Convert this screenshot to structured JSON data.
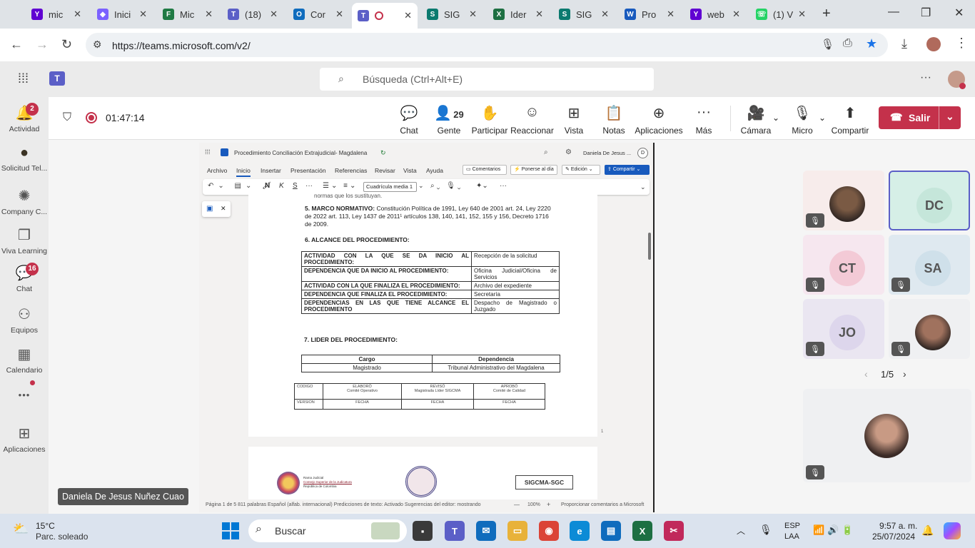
{
  "browser": {
    "tabs": [
      {
        "label": "mic",
        "color": "#6001d2",
        "glyph": "Y"
      },
      {
        "label": "Inici",
        "color": "#7b61ff",
        "glyph": "◆"
      },
      {
        "label": "Mic",
        "color": "#1f7a44",
        "glyph": "F"
      },
      {
        "label": "(18)",
        "color": "#5b5fc7",
        "glyph": "T"
      },
      {
        "label": "Cor",
        "color": "#0f6cbd",
        "glyph": "O"
      },
      {
        "label": "",
        "color": "#5b5fc7",
        "glyph": "T"
      },
      {
        "label": "SIG",
        "color": "#0b7a6f",
        "glyph": "S"
      },
      {
        "label": "Ider",
        "color": "#1d6f42",
        "glyph": "X"
      },
      {
        "label": "SIG",
        "color": "#0b7a6f",
        "glyph": "S"
      },
      {
        "label": "Pro",
        "color": "#185abd",
        "glyph": "W"
      },
      {
        "label": "web",
        "color": "#6001d2",
        "glyph": "Y"
      },
      {
        "label": "(1) V",
        "color": "#25d366",
        "glyph": "☏"
      }
    ],
    "url": "https://teams.microsoft.com/v2/"
  },
  "teams": {
    "search_placeholder": "Búsqueda (Ctrl+Alt+E)",
    "timer": "01:47:14",
    "rail": [
      {
        "label": "Actividad",
        "icon": "bell-icon",
        "glyph": "🔔",
        "badge": "2"
      },
      {
        "label": "Solicitud Tel...",
        "icon": "seal-icon",
        "glyph": "●",
        "badge": ""
      },
      {
        "label": "Company C...",
        "icon": "company-icon",
        "glyph": "✺",
        "badge": ""
      },
      {
        "label": "Viva Learning",
        "icon": "book-icon",
        "glyph": "❐",
        "badge": ""
      },
      {
        "label": "Chat",
        "icon": "chat-icon",
        "glyph": "💬",
        "badge": "16"
      },
      {
        "label": "Equipos",
        "icon": "teams-icon",
        "glyph": "⚇",
        "badge": ""
      },
      {
        "label": "Calendario",
        "icon": "calendar-icon",
        "glyph": "▦",
        "badge": ""
      },
      {
        "label": "",
        "icon": "more-icon",
        "glyph": "•••",
        "badge": ""
      },
      {
        "label": "Aplicaciones",
        "icon": "plus-icon",
        "glyph": "⊞",
        "badge": ""
      }
    ],
    "toolbar": {
      "chat": "Chat",
      "people": "Gente",
      "people_count": "29",
      "raise": "Participar",
      "react": "Reaccionar",
      "view": "Vista",
      "notes": "Notas",
      "apps": "Aplicaciones",
      "more": "Más",
      "camera": "Cámara",
      "mic": "Micro",
      "share": "Compartir",
      "leave": "Salir"
    },
    "participants": [
      {
        "initials": "",
        "bg": "#f7eceb",
        "avbg": "#7a5a44",
        "muted": true
      },
      {
        "initials": "DC",
        "bg": "#d6efe7",
        "avbg": "#c5e6da",
        "muted": false
      },
      {
        "initials": "CT",
        "bg": "#f6e7ef",
        "avbg": "#f3cad6",
        "muted": true
      },
      {
        "initials": "SA",
        "bg": "#dfe9f0",
        "avbg": "#cfe0ea",
        "muted": true
      },
      {
        "initials": "JO",
        "bg": "#eae6f1",
        "avbg": "#ddd6ec",
        "muted": true
      },
      {
        "initials": "",
        "bg": "#eff0f2",
        "avbg": "#a0725e",
        "muted": true
      }
    ],
    "pager": "1/5",
    "presenter_name": "Daniela De Jesus Nuñez Cuao"
  },
  "word": {
    "doc_title": "Procedimiento Conciliación Extrajudicial- Magdalena",
    "user": "Daniela De Jesus ...",
    "user_initial": "D",
    "menu": [
      "Archivo",
      "Inicio",
      "Insertar",
      "Presentación",
      "Referencias",
      "Revisar",
      "Vista",
      "Ayuda"
    ],
    "btn_comments": "Comentarios",
    "btn_catchup": "Ponerse al día",
    "btn_edit": "Edición",
    "btn_share": "Compartir",
    "style_box": "Cuadrícula media 1",
    "cut_text": "normas que los sustituyan.",
    "section5_title": "5. MARCO NORMATIVO:",
    "section5_body": "Constitución Política de 1991, Ley 640 de 2001 art. 24, Ley 2220 de 2022 art. 113, Ley 1437 de 2011¹ artículos 138, 140, 141, 152, 155 y 156, Decreto 1716 de 2009.",
    "section6_title": "6. ALCANCE DEL PROCEDIMIENTO:",
    "scope_rows": [
      {
        "k": "ACTIVIDAD CON LA QUE SE DA INICIO AL PROCEDIMIENTO:",
        "v": "Recepción de la solicitud"
      },
      {
        "k": "DEPENDENCIA QUE DA INICIO AL PROCEDIMIENTO:",
        "v": "Oficina Judicial/Oficina de Servicios"
      },
      {
        "k": "ACTIVIDAD CON LA QUE FINALIZA EL PROCEDIMIENTO:",
        "v": "Archivo del expediente"
      },
      {
        "k": "DEPENDENCIA QUE FINALIZA EL PROCEDIMIENTO:",
        "v": "Secretaría"
      },
      {
        "k": "DEPENDENCIAS EN LAS QUE TIENE ALCANCE EL PROCEDIMIENTO",
        "v": "Despacho de Magistrado o Juzgado"
      }
    ],
    "section7_title": "7.  LIDER DEL PROCEDIMIENTO:",
    "leader_head": [
      "Cargo",
      "Dependencia"
    ],
    "leader_row": [
      "Magistrado",
      "Tribunal Administrativo del Magdalena"
    ],
    "footer_table": {
      "r1": [
        "CODIGO",
        "ELABORÓ\nComité Operativo",
        "REVISÓ\nMagistrada Líder SIGCMA",
        "APROBÓ\nComité de Calidad"
      ],
      "r2": [
        "VERSION",
        "FECHA",
        "FECHA",
        "FECHA"
      ]
    },
    "page_num": "1",
    "p2_org1": "Rama Judicial",
    "p2_org2": "Consejo Superior de la Judicatura",
    "p2_org3": "República de Colombia",
    "p2_box": "SIGCMA-SGC",
    "status": "Página 1 de 5   811 palabras   Español (alfab. internacional)   Predicciones de texto: Activado   Sugerencias del editor: mostrando",
    "zoom": "100%",
    "feedback": "Proporcionar comentarios a Microsoft"
  },
  "taskbar": {
    "temp": "15°C",
    "weather": "Parc. soleado",
    "search": "Buscar",
    "lang1": "ESP",
    "lang2": "LAA",
    "time": "9:57 a. m.",
    "date": "25/07/2024"
  }
}
